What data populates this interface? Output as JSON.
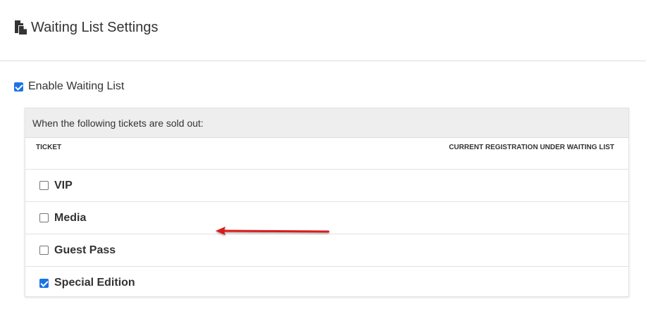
{
  "header": {
    "title": "Waiting List Settings",
    "icon": "document-copy-icon"
  },
  "enable": {
    "label": "Enable Waiting List",
    "checked": true
  },
  "panel": {
    "heading": "When the following tickets are sold out:",
    "columns": {
      "ticket": "TICKET",
      "current": "CURRENT REGISTRATION UNDER WAITING LIST"
    },
    "tickets": [
      {
        "name": "VIP",
        "checked": false
      },
      {
        "name": "Media",
        "checked": false
      },
      {
        "name": "Guest Pass",
        "checked": false
      },
      {
        "name": "Special Edition",
        "checked": true
      }
    ]
  },
  "annotation": {
    "arrow_color": "#d81e1e"
  }
}
